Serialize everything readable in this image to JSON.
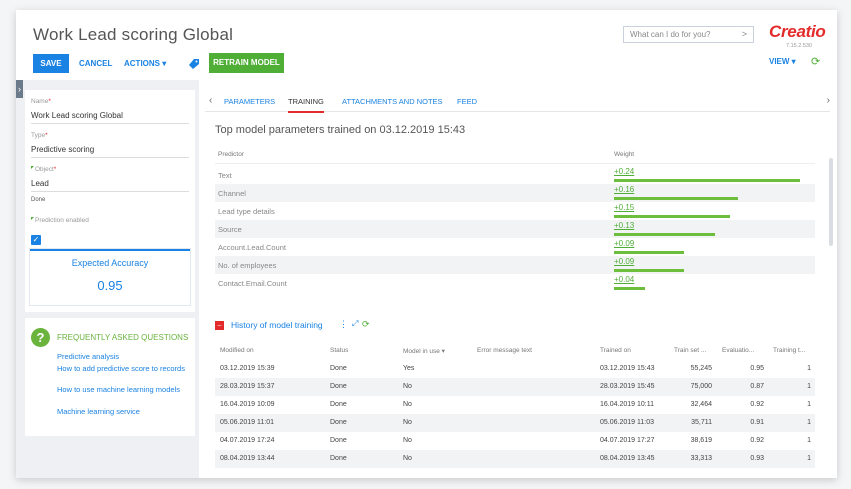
{
  "header": {
    "title": "Work Lead scoring Global",
    "save_label": "SAVE",
    "cancel_label": "CANCEL",
    "actions_label": "ACTIONS ▾",
    "retrain_label": "RETRAIN MODEL",
    "search_placeholder": "What can I do for you?",
    "logo": "Creatio",
    "version": "7.15.2.530",
    "view_label": "VIEW ▾"
  },
  "left": {
    "name_label": "Name",
    "name_value": "Work Lead scoring Global",
    "type_label": "Type",
    "type_value": "Predictive scoring",
    "object_label": "Object",
    "object_value": "Lead",
    "done_text": "Done",
    "prediction_label": "Prediction enabled",
    "prediction_enabled": true,
    "accuracy_title": "Expected Accuracy",
    "accuracy_value": "0.95"
  },
  "faq": {
    "title": "FREQUENTLY ASKED QUESTIONS",
    "links": [
      "Predictive analysis",
      "How to add predictive score to records",
      "How to use machine learning models",
      "Machine learning service"
    ]
  },
  "tabs": [
    "PARAMETERS",
    "TRAINING",
    "ATTACHMENTS AND NOTES",
    "FEED"
  ],
  "active_tab": "TRAINING",
  "params": {
    "title": "Top model parameters trained on 03.12.2019 15:43",
    "col_predictor": "Predictor",
    "col_weight": "Weight",
    "rows": [
      {
        "name": "Text",
        "weight": "+0.24",
        "value": 0.24
      },
      {
        "name": "Channel",
        "weight": "+0.16",
        "value": 0.16
      },
      {
        "name": "Lead type details",
        "weight": "+0.15",
        "value": 0.15
      },
      {
        "name": "Source",
        "weight": "+0.13",
        "value": 0.13
      },
      {
        "name": "Account.Lead.Count",
        "weight": "+0.09",
        "value": 0.09
      },
      {
        "name": "No. of employees",
        "weight": "+0.09",
        "value": 0.09
      },
      {
        "name": "Contact.Email.Count",
        "weight": "+0.04",
        "value": 0.04
      }
    ]
  },
  "history": {
    "title": "History of model training",
    "columns": [
      "Modified on",
      "Status",
      "Model in use ▾",
      "Error message text",
      "Trained on",
      "Train set ...",
      "Evaluatio...",
      "Training t..."
    ],
    "rows": [
      [
        "03.12.2019 15:39",
        "Done",
        "Yes",
        "",
        "03.12.2019 15:43",
        "55,245",
        "0.95",
        "1"
      ],
      [
        "28.03.2019 15:37",
        "Done",
        "No",
        "",
        "28.03.2019 15:45",
        "75,000",
        "0.87",
        "1"
      ],
      [
        "16.04.2019 10:09",
        "Done",
        "No",
        "",
        "16.04.2019 10:11",
        "32,464",
        "0.92",
        "1"
      ],
      [
        "05.06.2019 11:01",
        "Done",
        "No",
        "",
        "05.06.2019 11:03",
        "35,711",
        "0.91",
        "1"
      ],
      [
        "04.07.2019 17:24",
        "Done",
        "No",
        "",
        "04.07.2019 17:27",
        "38,619",
        "0.92",
        "1"
      ],
      [
        "08.04.2019 13:44",
        "Done",
        "No",
        "",
        "08.04.2019 13:45",
        "33,313",
        "0.93",
        "1"
      ]
    ]
  },
  "colors": {
    "accent": "#1a82e2",
    "green": "#4fae36",
    "red": "#e42b2b"
  }
}
